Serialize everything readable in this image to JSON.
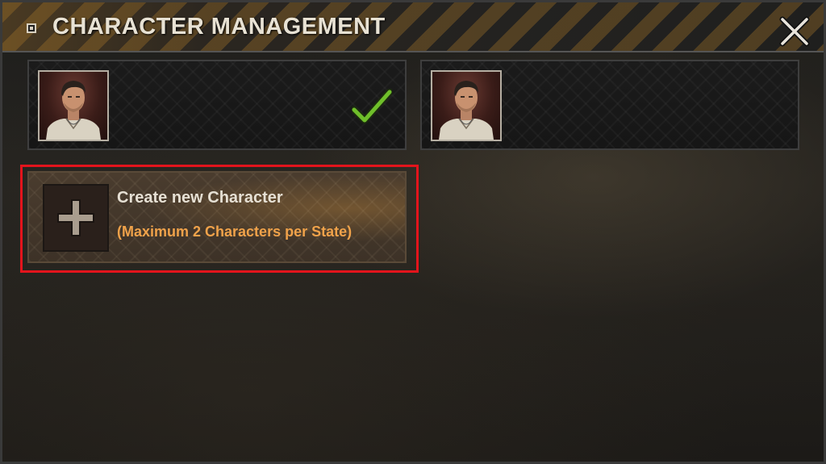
{
  "window": {
    "title": "CHARACTER MANAGEMENT"
  },
  "icons": {
    "title_bullet": "square-bullet-icon",
    "close": "close-x-icon",
    "selected": "checkmark-icon",
    "add": "plus-icon"
  },
  "characters": [
    {
      "portrait": "character-portrait",
      "selected": true
    },
    {
      "portrait": "character-portrait",
      "selected": false
    }
  ],
  "create": {
    "label": "Create new Character",
    "sublabel": "(Maximum 2 Characters per State)"
  },
  "colors": {
    "highlight_outline": "#e3141c",
    "sublabel": "#f0a24a",
    "check": "#6fbf2a"
  }
}
